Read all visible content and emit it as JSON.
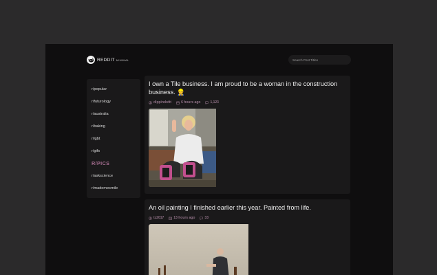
{
  "header": {
    "brand": "REDDIT",
    "brand_sub": "MINIMAL",
    "search_placeholder": "Search Post Titles"
  },
  "sidebar": {
    "items": [
      {
        "label": "r/popular"
      },
      {
        "label": "r/futurology"
      },
      {
        "label": "r/australia"
      },
      {
        "label": "r/baking"
      },
      {
        "label": "r/lgbt"
      },
      {
        "label": "r/gifs"
      },
      {
        "label": "R/PICS",
        "active": true
      },
      {
        "label": "r/askscience"
      },
      {
        "label": "r/mademesmile"
      }
    ]
  },
  "posts": [
    {
      "title": "I own a Tile business. I am proud to be a woman in the construction business. 👷",
      "author": "dippindottt",
      "time": "6 hours ago",
      "comments": "1,123",
      "image_desc": "woman-with-knee-pads"
    },
    {
      "title": "An oil painting I finished earlier this year. Painted from life.",
      "author": "tz2017",
      "time": "13 hours ago",
      "comments": "33",
      "image_desc": "oil-painting-old-man-seated"
    }
  ],
  "colors": {
    "background": "#2b2a2b",
    "window": "#0f0e0f",
    "panel": "#1a191a",
    "accent": "#a86f93",
    "meta": "#8f7186",
    "text": "#f0f0f0"
  }
}
